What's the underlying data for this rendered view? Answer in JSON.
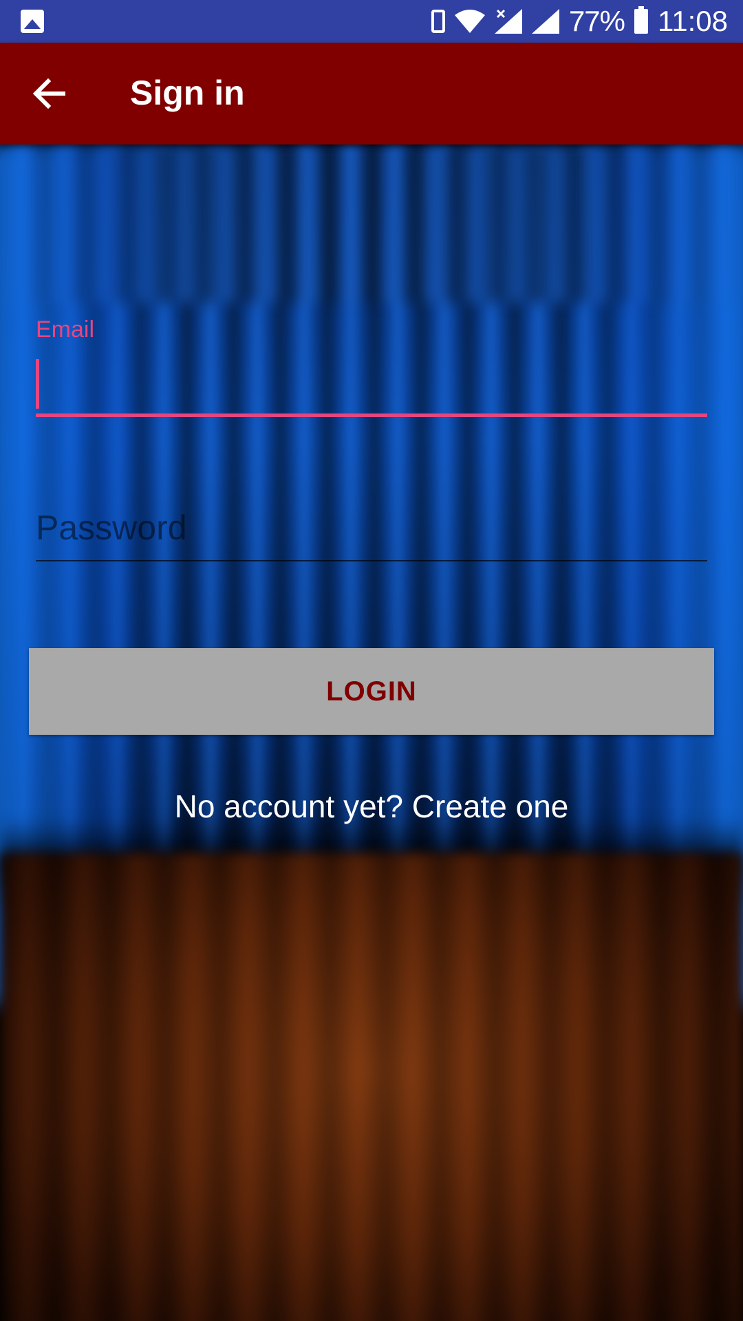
{
  "status_bar": {
    "battery_percent": "77%",
    "time": "11:08",
    "icons": [
      "image-icon",
      "phone-icon",
      "wifi-icon",
      "signal-icon",
      "signal-icon",
      "battery-icon"
    ],
    "background_color": "#3140a3"
  },
  "app_bar": {
    "title": "Sign in",
    "back_icon": "arrow-left-icon",
    "background_color": "#800000"
  },
  "form": {
    "email": {
      "label": "Email",
      "value": "",
      "accent_color": "#e8457e"
    },
    "password": {
      "placeholder": "Password",
      "value": ""
    },
    "login_button": {
      "label": "LOGIN",
      "background_color": "#a9a9a9",
      "text_color": "#800000"
    },
    "create_account_link": "No account yet? Create one"
  }
}
